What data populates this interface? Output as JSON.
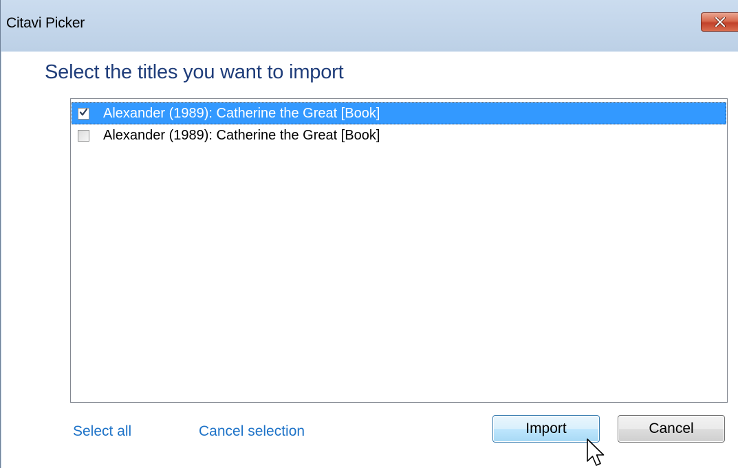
{
  "window": {
    "title": "Citavi Picker"
  },
  "dialog": {
    "heading": "Select the titles you want to import",
    "items": [
      {
        "label": "Alexander (1989): Catherine the Great [Book]",
        "checked": true,
        "selected": true
      },
      {
        "label": "Alexander (1989): Catherine the Great [Book]",
        "checked": false,
        "selected": false
      }
    ],
    "links": {
      "select_all": "Select all",
      "cancel_selection": "Cancel selection"
    },
    "buttons": {
      "import": "Import",
      "cancel": "Cancel"
    }
  },
  "colors": {
    "selection": "#3399ff",
    "heading": "#1f3d7a",
    "link": "#1e73c8",
    "titlebar": "#bcd0e6",
    "close_button": "#c2412a"
  },
  "icons": {
    "close": "close-icon",
    "check": "checkmark-icon",
    "cursor": "mouse-pointer-icon"
  }
}
